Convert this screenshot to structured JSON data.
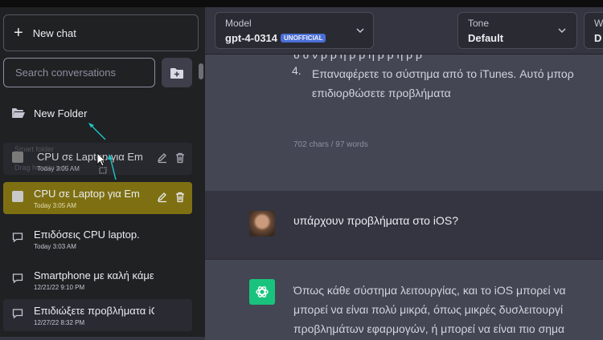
{
  "sidebar": {
    "new_chat_label": "New chat",
    "search_placeholder": "Search conversations",
    "folder_name": "New Folder",
    "drag_ghost": {
      "title": "CPU σε Laptop για Em",
      "date": "Today 3:05 AM",
      "underlay_top": "Smart folder",
      "underlay_bottom": "Drag here to add"
    },
    "items": [
      {
        "title": "CPU σε Laptop για Em",
        "date": "Today 3:05 AM"
      },
      {
        "title": "Επιδόσεις CPU laptop.",
        "date": "Today 3:03 AM"
      },
      {
        "title": "Smartphone με καλή κάμερα",
        "date": "12/21/22 9:10 PM"
      },
      {
        "title": "Επιδιώξετε προβλήματα iOS",
        "date": "12/27/22 8:32 PM"
      }
    ]
  },
  "header": {
    "model_label": "Model",
    "model_value": "gpt-4-0314",
    "model_badge": "UNOFFICIAL",
    "tone_label": "Tone",
    "tone_value": "Default",
    "third_label": "W",
    "third_value": "D"
  },
  "conversation": {
    "reply1": {
      "partial_line": "υ υ ν ρ ρ η ρ ρ η ρ ρ η ρ ρ",
      "number": "4.",
      "lines": [
        "Επαναφέρετε το σύστημα από το iTunes. Αυτό μπορ",
        "επιδιορθώσετε προβλήματα"
      ],
      "counter": "702 chars / 97 words"
    },
    "user_text": "υπάρχουν προβλήματα στο iOS?",
    "reply2_lines": [
      "Όπως κάθε σύστημα λειτουργίας, και το iOS μπορεί να",
      "μπορεί να είναι πολύ μικρά, όπως μικρές δυσλειτουργί",
      "προβλημάτων εφαρμογών, ή μπορεί να είναι πιο σημα"
    ]
  },
  "colors": {
    "active_item": "#7e7012",
    "sidebar_bg": "#202123",
    "main_bg": "#343541",
    "reply_bg": "#444654",
    "badge": "#4a6fd8",
    "gpt_green": "#19c37d",
    "drag_arrow": "#1fc6c6"
  }
}
